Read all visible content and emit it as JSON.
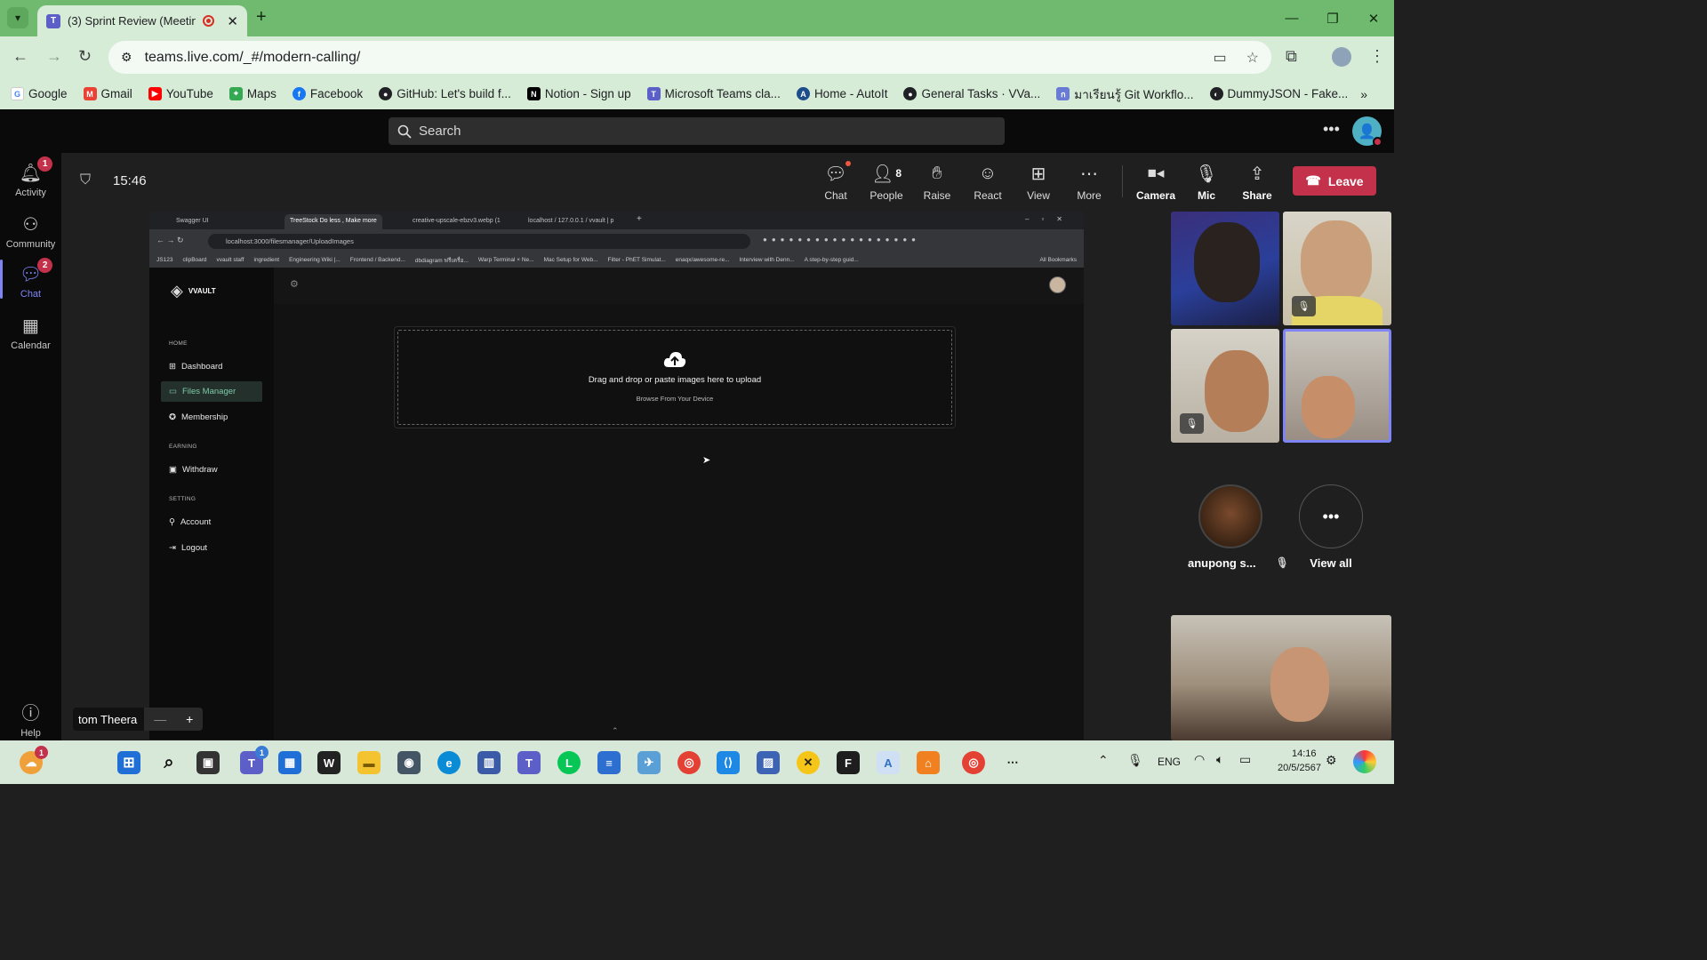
{
  "browser": {
    "tab_title": "(3) Sprint Review (Meeting)",
    "url": "teams.live.com/_#/modern-calling/",
    "bookmarks": [
      "Google",
      "Gmail",
      "YouTube",
      "Maps",
      "Facebook",
      "GitHub: Let's build f...",
      "Notion - Sign up",
      "Microsoft Teams cla...",
      "Home - AutoIt",
      "General Tasks · VVa...",
      "มาเรียนรู้ Git Workflo...",
      "DummyJSON - Fake..."
    ]
  },
  "teams": {
    "search_placeholder": "Search",
    "rail": [
      {
        "label": "Activity",
        "badge": "1"
      },
      {
        "label": "Community",
        "badge": ""
      },
      {
        "label": "Chat",
        "badge": "2"
      },
      {
        "label": "Calendar",
        "badge": ""
      },
      {
        "label": "Help",
        "badge": ""
      }
    ],
    "meeting_time": "15:46",
    "controls": {
      "chat": "Chat",
      "people": "People",
      "people_count": "8",
      "raise": "Raise",
      "react": "React",
      "view": "View",
      "more": "More",
      "camera": "Camera",
      "mic": "Mic",
      "share": "Share",
      "leave": "Leave"
    },
    "presenter_name": "tom Theera",
    "participant_name": "anupong s...",
    "view_all": "View all"
  },
  "shared_screen": {
    "tabs": [
      "Swagger UI",
      "TreeStock Do less , Make more",
      "creative-upscale-ebzv3.webp (1",
      "localhost / 127.0.0.1 / vvault | p"
    ],
    "url": "localhost:3000/filesmanager/UploadImages",
    "bookmarks": [
      "JS123",
      "clipBoard",
      "vvault staff",
      "ingredient",
      "Engineering Wiki |...",
      "Frontend / Backend...",
      "dbdiagram ฟรีเครื่อ...",
      "Warp Terminal × Ne...",
      "Mac Setup for Web...",
      "Filter - PhET Simulat...",
      "enaqx/awesome-re...",
      "Interview with Denn...",
      "A step-by-step guid...",
      "All Bookmarks"
    ],
    "app": {
      "brand": "VVAULT",
      "sections": [
        {
          "title": "HOME",
          "items": [
            "Dashboard",
            "Files Manager",
            "Membership"
          ]
        },
        {
          "title": "EARNING",
          "items": [
            "Withdraw"
          ]
        },
        {
          "title": "SETTING",
          "items": [
            "Account",
            "Logout"
          ]
        }
      ],
      "upload_text": "Drag and drop or paste images here to upload",
      "browse_text": "Browse From Your Device"
    }
  },
  "taskbar": {
    "lang": "ENG",
    "time": "14:16",
    "date": "20/5/2567",
    "teams_badge": "1",
    "notify_badge": "1"
  },
  "colors": {
    "accent": "#7f85f5",
    "leave": "#c4314b",
    "chrome": "#d7ecd7",
    "tabbar": "#6fba6f"
  }
}
